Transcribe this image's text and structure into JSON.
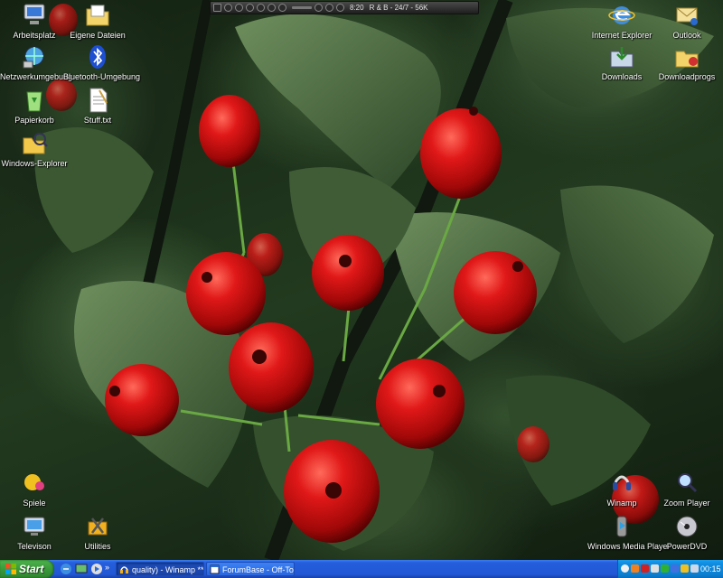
{
  "desktop": {
    "icons_left": [
      {
        "label": "Arbeitsplatz",
        "icon": "my-computer-icon"
      },
      {
        "label": "Eigene Dateien",
        "icon": "my-documents-icon"
      },
      {
        "label": "Netzwerkumgebung",
        "icon": "network-icon"
      },
      {
        "label": "Bluetooth-Umgebung",
        "icon": "bluetooth-icon"
      },
      {
        "label": "Papierkorb",
        "icon": "recycle-bin-icon"
      },
      {
        "label": "Stuff.txt",
        "icon": "text-file-icon"
      },
      {
        "label": "Windows-Explorer",
        "icon": "explorer-icon"
      }
    ],
    "icons_right": [
      {
        "label": "Internet Explorer",
        "icon": "internet-explorer-icon"
      },
      {
        "label": "Outlook",
        "icon": "outlook-icon"
      },
      {
        "label": "Downloads",
        "icon": "downloads-folder-icon"
      },
      {
        "label": "Downloadprogs",
        "icon": "downloadprogs-folder-icon"
      }
    ],
    "icons_bottom_left": [
      {
        "label": "Spiele",
        "icon": "games-icon"
      },
      {
        "label": "Televison",
        "icon": "television-icon"
      },
      {
        "label": "Utilities",
        "icon": "utilities-icon"
      }
    ],
    "icons_bottom_right": [
      {
        "label": "Winamp",
        "icon": "winamp-icon"
      },
      {
        "label": "Zoom Player",
        "icon": "zoom-player-icon"
      },
      {
        "label": "Windows Media Player",
        "icon": "media-player-icon"
      },
      {
        "label": "PowerDVD",
        "icon": "powerdvd-icon"
      }
    ]
  },
  "winamp": {
    "time": "8:20",
    "station": "R & B - 24/7 - 56K"
  },
  "taskbar": {
    "start_label": "Start",
    "tasks": [
      {
        "label": "quality) - Winamp **...",
        "active": true
      },
      {
        "label": "ForumBase - Off-Topi...",
        "active": false
      }
    ],
    "clock": "00:15"
  },
  "colors": {
    "berry": "#d01414",
    "taskbar": "#245edb",
    "start": "#3a9a3a",
    "tray": "#0f8de0"
  }
}
